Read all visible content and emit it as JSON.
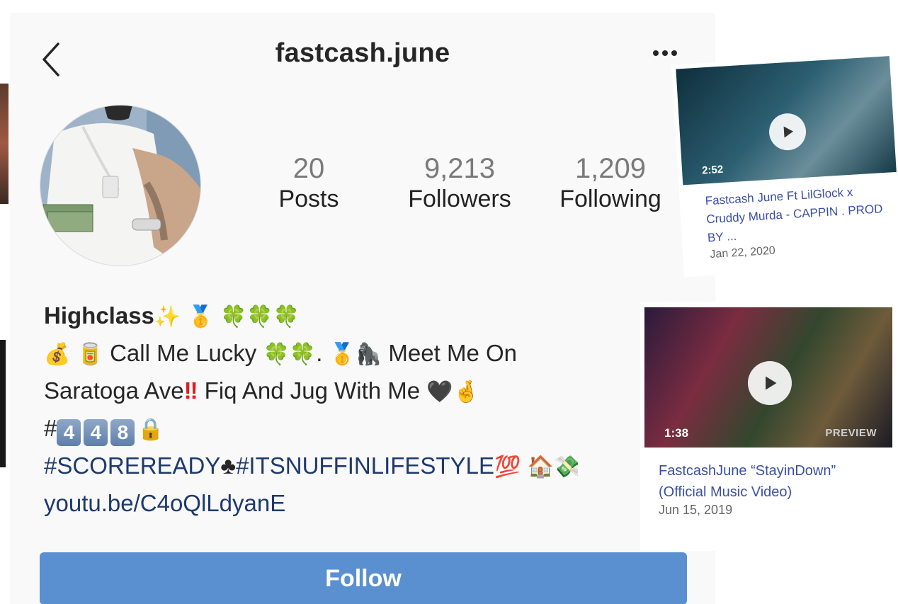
{
  "profile": {
    "username": "fastcash.june",
    "stats": {
      "posts": {
        "value": "20",
        "label": "Posts"
      },
      "followers": {
        "value": "9,213",
        "label": "Followers"
      },
      "following": {
        "value": "1,209",
        "label": "Following"
      }
    },
    "bio": {
      "name": "Highclass",
      "line2_text": "Call Me Lucky",
      "line2_mid": ".",
      "line2_end": "Meet Me On",
      "line3_text": "Saratoga Ave",
      "line3_end": "Fiq And Jug With Me",
      "line4_hash": "#",
      "keycaps": [
        "4",
        "4",
        "8"
      ],
      "hashtag1": "#SCOREREADY",
      "hashtag2": "#ITSNUFFINLIFESTYLE",
      "link": "youtu.be/C4oQlLdyanE"
    },
    "follow_label": "Follow",
    "colors": {
      "follow_button": "#5a8fd0",
      "hashtag": "#1e3a6d",
      "background": "#f9f9f9"
    }
  },
  "videos": [
    {
      "duration": "2:52",
      "title": "Fastcash June Ft LilGlock x Cruddy Murda - CAPPIN . PROD BY ...",
      "date": "Jan 22, 2020"
    },
    {
      "duration": "1:38",
      "badge": "PREVIEW",
      "title": "FastcashJune “StayinDown” (Official Music Video)",
      "date": "Jun 15, 2019"
    }
  ]
}
